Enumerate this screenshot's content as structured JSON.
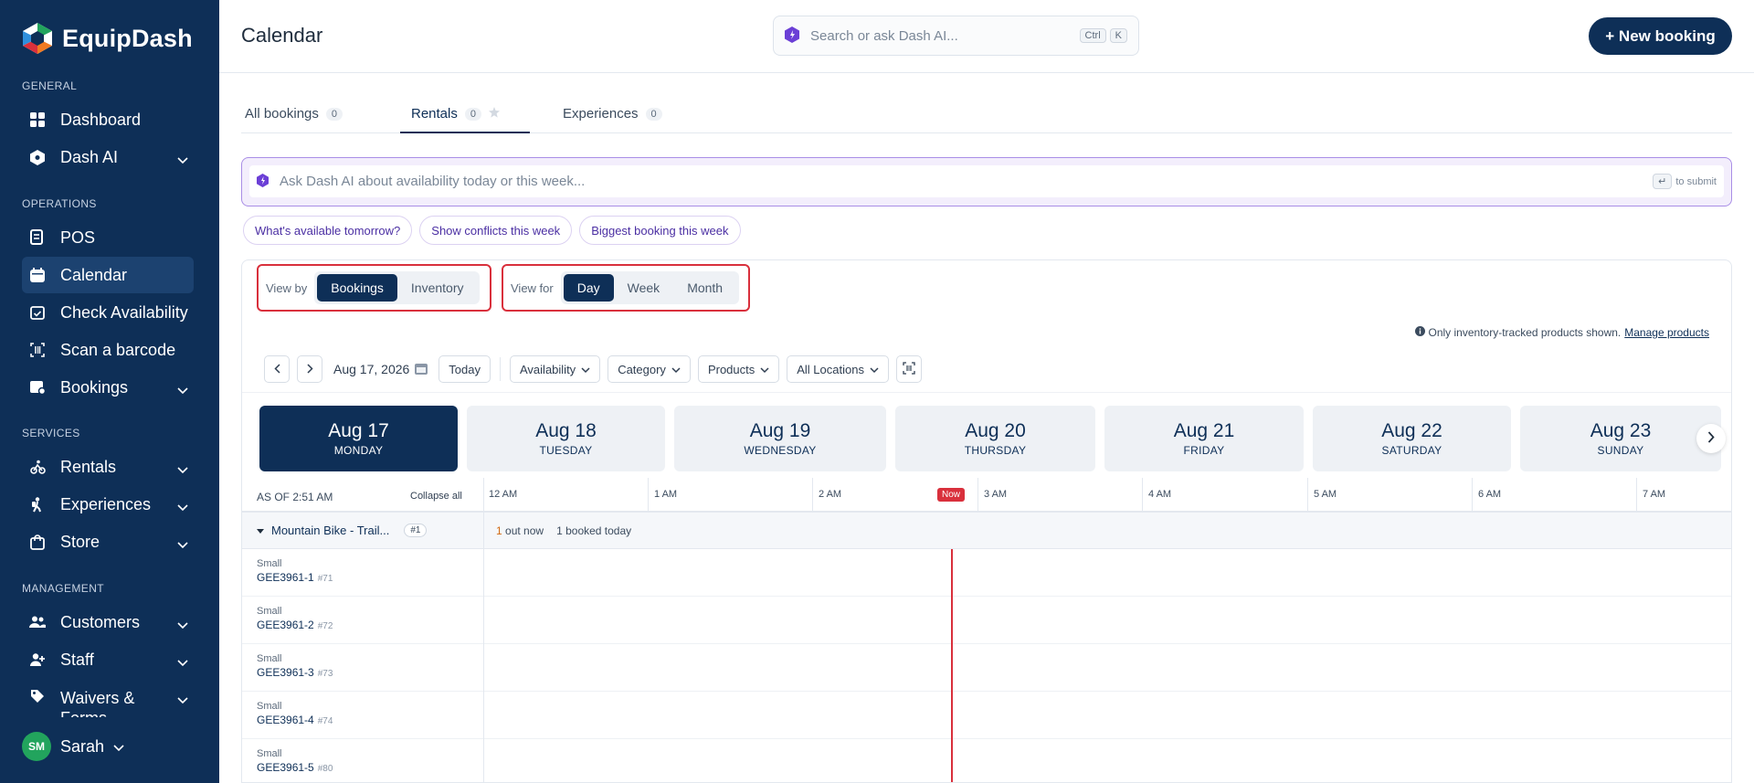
{
  "app": {
    "name": "EquipDash"
  },
  "sidebar": {
    "sections": {
      "general": "GENERAL",
      "operations": "OPERATIONS",
      "services": "SERVICES",
      "management": "MANAGEMENT"
    },
    "items": [
      {
        "label": "Dashboard",
        "icon": "grid-icon"
      },
      {
        "label": "Dash AI",
        "icon": "hex-ai-icon"
      },
      {
        "label": "POS",
        "icon": "receipt-icon"
      },
      {
        "label": "Calendar",
        "icon": "calendar-icon",
        "active": true
      },
      {
        "label": "Check Availability",
        "icon": "calendar-check-icon"
      },
      {
        "label": "Scan a barcode",
        "icon": "barcode-icon"
      },
      {
        "label": "Bookings",
        "icon": "bookings-icon"
      },
      {
        "label": "Rentals",
        "icon": "bike-icon"
      },
      {
        "label": "Experiences",
        "icon": "hiker-icon"
      },
      {
        "label": "Store",
        "icon": "store-bag-icon"
      },
      {
        "label": "Customers",
        "icon": "users-icon"
      },
      {
        "label": "Staff",
        "icon": "staff-icon"
      },
      {
        "label": "Waivers & Forms",
        "icon": "tag-icon"
      }
    ],
    "user": {
      "initials": "SM",
      "name": "Sarah"
    }
  },
  "header": {
    "title": "Calendar",
    "search_placeholder": "Search or ask Dash AI...",
    "kbd1": "Ctrl",
    "kbd2": "K",
    "new_booking": "+ New booking"
  },
  "tabs": [
    {
      "label": "All bookings",
      "count": "0"
    },
    {
      "label": "Rentals",
      "count": "0",
      "active": true
    },
    {
      "label": "Experiences",
      "count": "0"
    }
  ],
  "ai": {
    "placeholder": "Ask Dash AI about availability today or this week...",
    "submit_hint": "to submit",
    "chips": [
      "What's available tomorrow?",
      "Show conflicts this week",
      "Biggest booking this week"
    ]
  },
  "view": {
    "by_label": "View by",
    "by_options": [
      "Bookings",
      "Inventory"
    ],
    "by_selected": "Bookings",
    "for_label": "View for",
    "for_options": [
      "Day",
      "Week",
      "Month"
    ],
    "for_selected": "Day"
  },
  "notice": {
    "text": "Only inventory-tracked products shown.",
    "link": "Manage products"
  },
  "filters": {
    "date": "Aug 17, 2026",
    "today": "Today",
    "availability": "Availability",
    "category": "Category",
    "products": "Products",
    "locations": "All Locations"
  },
  "days": [
    {
      "date": "Aug 17",
      "weekday": "MONDAY",
      "selected": true
    },
    {
      "date": "Aug 18",
      "weekday": "TUESDAY"
    },
    {
      "date": "Aug 19",
      "weekday": "WEDNESDAY"
    },
    {
      "date": "Aug 20",
      "weekday": "THURSDAY"
    },
    {
      "date": "Aug 21",
      "weekday": "FRIDAY"
    },
    {
      "date": "Aug 22",
      "weekday": "SATURDAY"
    },
    {
      "date": "Aug 23",
      "weekday": "SUNDAY"
    }
  ],
  "timeline": {
    "as_of": "AS OF 2:51 AM",
    "collapse": "Collapse all",
    "now": "Now",
    "hours": [
      "12 AM",
      "1 AM",
      "2 AM",
      "3 AM",
      "4 AM",
      "5 AM",
      "6 AM",
      "7 AM"
    ]
  },
  "group": {
    "name": "Mountain Bike - Trail...",
    "badge": "#1",
    "out_count": "1",
    "out_label": "out now",
    "booked_count": "1",
    "booked_label": "booked today"
  },
  "items": [
    {
      "size": "Small",
      "id": "GEE3961-1",
      "num": "#71"
    },
    {
      "size": "Small",
      "id": "GEE3961-2",
      "num": "#72"
    },
    {
      "size": "Small",
      "id": "GEE3961-3",
      "num": "#73"
    },
    {
      "size": "Small",
      "id": "GEE3961-4",
      "num": "#74"
    },
    {
      "size": "Small",
      "id": "GEE3961-5",
      "num": "#80"
    }
  ],
  "colors": {
    "primary": "#0e2f57",
    "accent_red": "#d9303c",
    "ai_purple": "#a98ee6",
    "avatar_green": "#22a45d"
  }
}
